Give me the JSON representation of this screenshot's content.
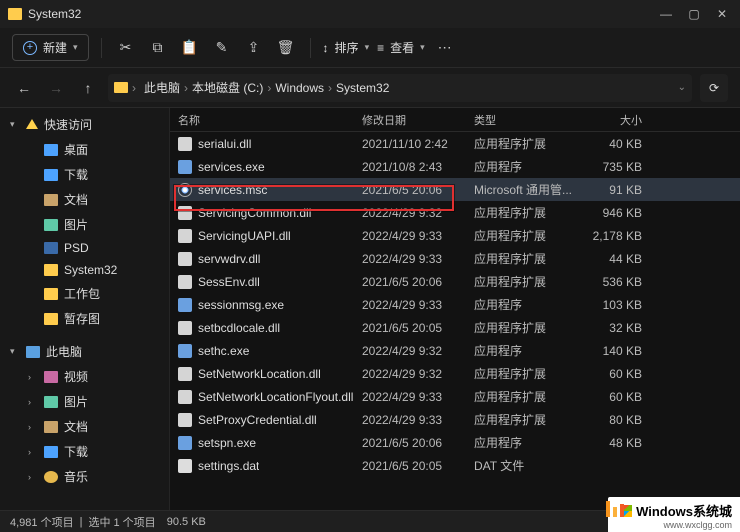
{
  "window": {
    "title": "System32"
  },
  "toolbar": {
    "new": "新建",
    "sort": "排序",
    "view": "查看"
  },
  "breadcrumbs": [
    "此电脑",
    "本地磁盘 (C:)",
    "Windows",
    "System32"
  ],
  "sidebar": {
    "quick": {
      "label": "快速访问",
      "expanded": true
    },
    "items_quick": [
      {
        "label": "桌面",
        "icon": "desktop"
      },
      {
        "label": "下载",
        "icon": "download"
      },
      {
        "label": "文档",
        "icon": "docs"
      },
      {
        "label": "图片",
        "icon": "pics"
      },
      {
        "label": "PSD",
        "icon": "psd"
      },
      {
        "label": "System32",
        "icon": "folder"
      },
      {
        "label": "工作包",
        "icon": "folder"
      },
      {
        "label": "暂存图",
        "icon": "folder"
      }
    ],
    "thispc": {
      "label": "此电脑",
      "expanded": true
    },
    "items_pc": [
      {
        "label": "视频",
        "icon": "video"
      },
      {
        "label": "图片",
        "icon": "pics"
      },
      {
        "label": "文档",
        "icon": "docs"
      },
      {
        "label": "下载",
        "icon": "download"
      },
      {
        "label": "音乐",
        "icon": "music"
      }
    ]
  },
  "columns": {
    "name": "名称",
    "date": "修改日期",
    "type": "类型",
    "size": "大小"
  },
  "type_labels": {
    "dll": "应用程序扩展",
    "exe": "应用程序",
    "msc": "Microsoft 通用管...",
    "dat": "DAT 文件"
  },
  "files": [
    {
      "name": "serialui.dll",
      "date": "2021/11/10 2:42",
      "type": "dll",
      "size": "40 KB"
    },
    {
      "name": "services.exe",
      "date": "2021/10/8 2:43",
      "type": "exe",
      "size": "735 KB"
    },
    {
      "name": "services.msc",
      "date": "2021/6/5 20:06",
      "type": "msc",
      "size": "91 KB",
      "selected": true
    },
    {
      "name": "ServicingCommon.dll",
      "date": "2022/4/29 9:32",
      "type": "dll",
      "size": "946 KB"
    },
    {
      "name": "ServicingUAPI.dll",
      "date": "2022/4/29 9:33",
      "type": "dll",
      "size": "2,178 KB"
    },
    {
      "name": "servwdrv.dll",
      "date": "2022/4/29 9:33",
      "type": "dll",
      "size": "44 KB"
    },
    {
      "name": "SessEnv.dll",
      "date": "2021/6/5 20:06",
      "type": "dll",
      "size": "536 KB"
    },
    {
      "name": "sessionmsg.exe",
      "date": "2022/4/29 9:33",
      "type": "exe",
      "size": "103 KB"
    },
    {
      "name": "setbcdlocale.dll",
      "date": "2021/6/5 20:05",
      "type": "dll",
      "size": "32 KB"
    },
    {
      "name": "sethc.exe",
      "date": "2022/4/29 9:32",
      "type": "exe",
      "size": "140 KB"
    },
    {
      "name": "SetNetworkLocation.dll",
      "date": "2022/4/29 9:32",
      "type": "dll",
      "size": "60 KB"
    },
    {
      "name": "SetNetworkLocationFlyout.dll",
      "date": "2022/4/29 9:33",
      "type": "dll",
      "size": "60 KB"
    },
    {
      "name": "SetProxyCredential.dll",
      "date": "2022/4/29 9:33",
      "type": "dll",
      "size": "80 KB"
    },
    {
      "name": "setspn.exe",
      "date": "2021/6/5 20:06",
      "type": "exe",
      "size": "48 KB"
    },
    {
      "name": "settings.dat",
      "date": "2021/6/5 20:05",
      "type": "dat",
      "size": ""
    }
  ],
  "status": {
    "count": "4,981 个项目",
    "selected": "选中 1 个项目",
    "size": "90.5 KB"
  },
  "watermark": {
    "brand": "Windows系统城",
    "url": "www.wxclgg.com"
  }
}
